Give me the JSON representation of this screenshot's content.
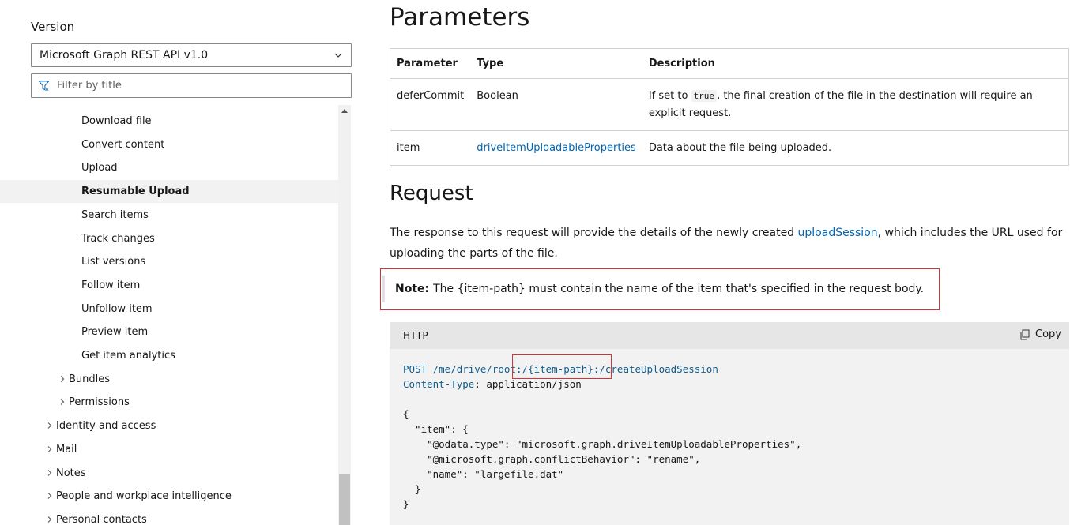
{
  "sidebar": {
    "version_label": "Version",
    "version_value": "Microsoft Graph REST API v1.0",
    "filter_placeholder": "Filter by title",
    "items": [
      {
        "label": "Download file",
        "indent": 3,
        "has_arrow": false,
        "active": false
      },
      {
        "label": "Convert content",
        "indent": 3,
        "has_arrow": false,
        "active": false
      },
      {
        "label": "Upload",
        "indent": 3,
        "has_arrow": false,
        "active": false
      },
      {
        "label": "Resumable Upload",
        "indent": 3,
        "has_arrow": false,
        "active": true
      },
      {
        "label": "Search items",
        "indent": 3,
        "has_arrow": false,
        "active": false
      },
      {
        "label": "Track changes",
        "indent": 3,
        "has_arrow": false,
        "active": false
      },
      {
        "label": "List versions",
        "indent": 3,
        "has_arrow": false,
        "active": false
      },
      {
        "label": "Follow item",
        "indent": 3,
        "has_arrow": false,
        "active": false
      },
      {
        "label": "Unfollow item",
        "indent": 3,
        "has_arrow": false,
        "active": false
      },
      {
        "label": "Preview item",
        "indent": 3,
        "has_arrow": false,
        "active": false
      },
      {
        "label": "Get item analytics",
        "indent": 3,
        "has_arrow": false,
        "active": false
      },
      {
        "label": "Bundles",
        "indent": 2,
        "has_arrow": true,
        "active": false
      },
      {
        "label": "Permissions",
        "indent": 2,
        "has_arrow": true,
        "active": false
      },
      {
        "label": "Identity and access",
        "indent": 1,
        "has_arrow": true,
        "active": false
      },
      {
        "label": "Mail",
        "indent": 1,
        "has_arrow": true,
        "active": false
      },
      {
        "label": "Notes",
        "indent": 1,
        "has_arrow": true,
        "active": false
      },
      {
        "label": "People and workplace intelligence",
        "indent": 1,
        "has_arrow": true,
        "active": false
      },
      {
        "label": "Personal contacts",
        "indent": 1,
        "has_arrow": true,
        "active": false
      }
    ]
  },
  "main": {
    "parameters_title": "Parameters",
    "table": {
      "headers": [
        "Parameter",
        "Type",
        "Description"
      ],
      "rows": [
        {
          "param": "deferCommit",
          "type": "Boolean",
          "type_is_link": false,
          "desc_before": "If set to ",
          "desc_code": "true",
          "desc_after": ", the final creation of the file in the destination will require an explicit request."
        },
        {
          "param": "item",
          "type": "driveItemUploadableProperties",
          "type_is_link": true,
          "desc_before": "Data about the file being uploaded.",
          "desc_code": "",
          "desc_after": ""
        }
      ]
    },
    "request_title": "Request",
    "request_text_before": "The response to this request will provide the details of the newly created ",
    "request_link": "uploadSession",
    "request_text_after": ", which includes the URL used for uploading the parts of the file.",
    "note_label": "Note:",
    "note_text": "The {item-path} must contain the name of the item that's specified in the request body.",
    "code": {
      "language": "HTTP",
      "copy_label": "Copy",
      "line1_method": "POST /me/drive/root:/{item-path}:/createUploadSession",
      "line2_key": "Content-Type",
      "line2_value": ": application/json",
      "body": "{\n  \"item\": {\n    \"@odata.type\": \"microsoft.graph.driveItemUploadableProperties\",\n    \"@microsoft.graph.conflictBehavior\": \"rename\",\n    \"name\": \"largefile.dat\"\n  }\n}"
    }
  },
  "colors": {
    "link": "#0065b3",
    "highlight_border": "#d13438",
    "code_keyword": "#0f5c8c",
    "active_bg": "#f2f2f2"
  }
}
